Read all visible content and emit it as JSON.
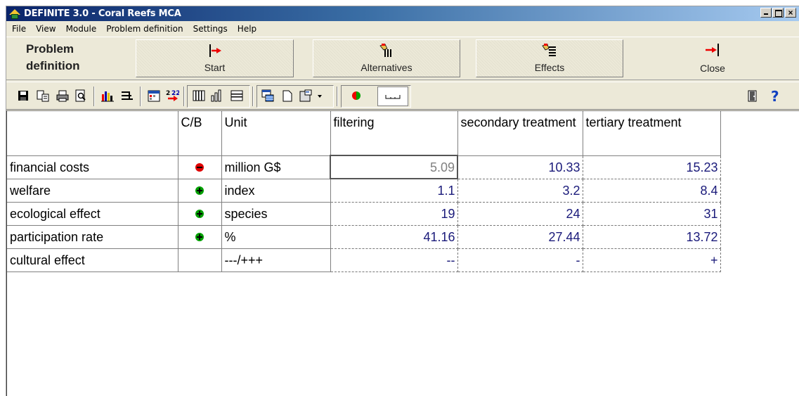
{
  "window": {
    "title": "DEFINITE 3.0 - Coral Reefs MCA"
  },
  "menu": [
    "File",
    "View",
    "Module",
    "Problem definition",
    "Settings",
    "Help"
  ],
  "module": {
    "title_line1": "Problem",
    "title_line2": "definition",
    "buttons": {
      "start": "Start",
      "alternatives": "Alternatives",
      "effects": "Effects",
      "close": "Close"
    }
  },
  "table": {
    "headers": {
      "effect": "",
      "cb": "C/B",
      "unit": "Unit",
      "alt1": "filtering",
      "alt2": "secondary treatment",
      "alt3": "tertiary treatment"
    },
    "rows": [
      {
        "effect": "financial costs",
        "cb": "cost",
        "unit": "million G$",
        "v1": "5.09",
        "v2": "10.33",
        "v3": "15.23"
      },
      {
        "effect": "welfare",
        "cb": "benefit",
        "unit": "index",
        "v1": "1.1",
        "v2": "3.2",
        "v3": "8.4"
      },
      {
        "effect": "ecological effect",
        "cb": "benefit",
        "unit": "species",
        "v1": "19",
        "v2": "24",
        "v3": "31"
      },
      {
        "effect": "participation rate",
        "cb": "benefit",
        "unit": "%",
        "v1": "41.16",
        "v2": "27.44",
        "v3": "13.72"
      },
      {
        "effect": "cultural effect",
        "cb": "",
        "unit": "---/+++",
        "v1": "--",
        "v2": "-",
        "v3": "+"
      }
    ]
  },
  "colors": {
    "cost": "#e00000",
    "benefit": "#00a000",
    "value_text": "#1a1a7a"
  }
}
